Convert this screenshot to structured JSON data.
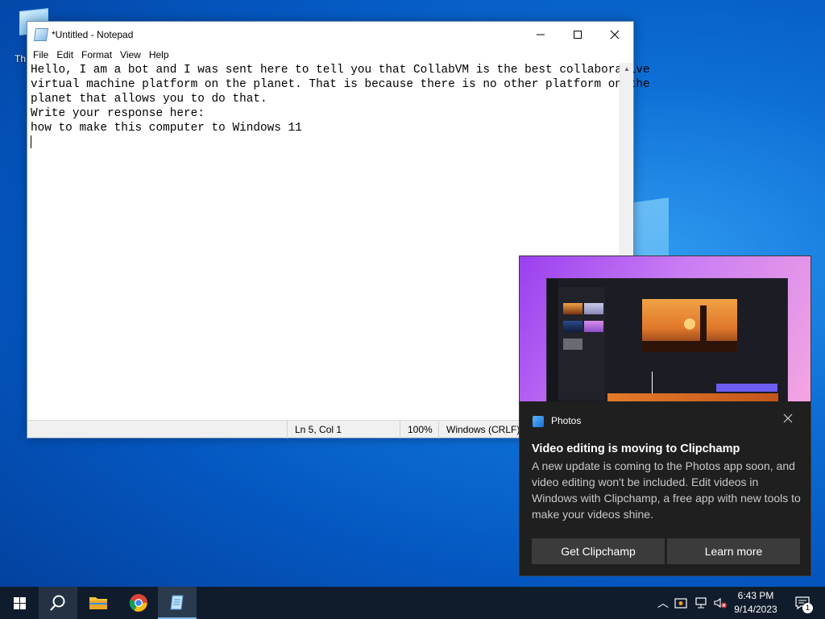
{
  "desktop": {
    "icon_label": "Th"
  },
  "notepad": {
    "title": "*Untitled - Notepad",
    "menu": [
      "File",
      "Edit",
      "Format",
      "View",
      "Help"
    ],
    "content_lines": [
      "Hello, I am a bot and I was sent here to tell you that CollabVM is the best collaborative",
      "virtual machine platform on the planet. That is because there is no other platform on the",
      "planet that allows you to do that.",
      "",
      "Write your response here:",
      "how to make this computer to Windows 11"
    ],
    "status": {
      "position": "Ln 5, Col 1",
      "zoom": "100%",
      "line_ending": "Windows (CRLF)"
    }
  },
  "toast": {
    "app_name": "Photos",
    "headline": "Video editing is moving to Clipchamp",
    "body": "A new update is coming to the Photos app soon, and video editing won't be included. Edit videos in Windows with Clipchamp, a free app with new tools to make your videos shine.",
    "primary_button": "Get Clipchamp",
    "secondary_button": "Learn more",
    "close_icon": "close-icon"
  },
  "taskbar": {
    "apps": [
      "start-icon",
      "search-icon",
      "file-explorer-icon",
      "chrome-icon",
      "notepad-icon"
    ],
    "clock_time": "6:43 PM",
    "clock_date": "9/14/2023",
    "notification_count": "1"
  },
  "colors": {
    "taskbar": "#101c2c",
    "toast_bg": "#1f1f1f",
    "button_bg": "#3b3b3b",
    "accent": "#76b9ed"
  }
}
